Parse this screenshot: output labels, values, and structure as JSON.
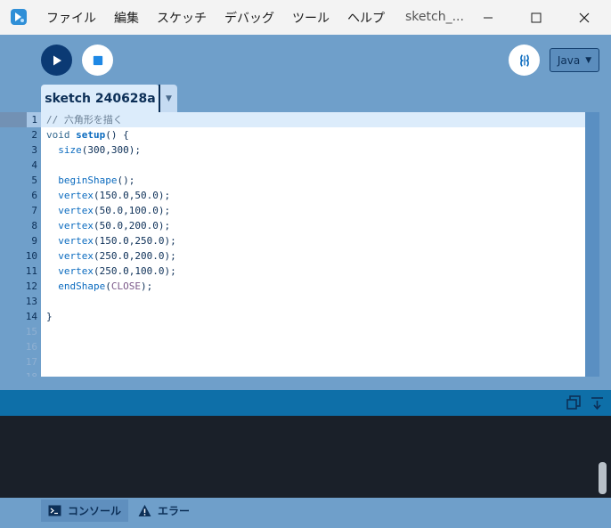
{
  "titlebar": {
    "menu": [
      "ファイル",
      "編集",
      "スケッチ",
      "デバッグ",
      "ツール",
      "ヘルプ"
    ],
    "window_title": "sketch_..."
  },
  "toolbar": {
    "mode": "Java"
  },
  "tab": {
    "label": "sketch 240628a"
  },
  "editor": {
    "line_numbers": [
      "1",
      "2",
      "3",
      "4",
      "5",
      "6",
      "7",
      "8",
      "9",
      "10",
      "11",
      "12",
      "13",
      "14",
      "15",
      "16",
      "17",
      "18"
    ],
    "lines": [
      "// 六角形を描く",
      "void setup() {",
      "  size(300,300);",
      "",
      "  beginShape();",
      "  vertex(150.0,50.0);",
      "  vertex(50.0,100.0);",
      "  vertex(50.0,200.0);",
      "  vertex(150.0,250.0);",
      "  vertex(250.0,200.0);",
      "  vertex(250.0,100.0);",
      "  endShape(CLOSE);",
      "",
      "}"
    ]
  },
  "bottom_tabs": {
    "console": "コンソール",
    "errors": "エラー"
  },
  "colors": {
    "accent": "#0b3a74",
    "background": "#6f9fca",
    "console_bg": "#1a2029",
    "console_header": "#0e6fa8"
  }
}
